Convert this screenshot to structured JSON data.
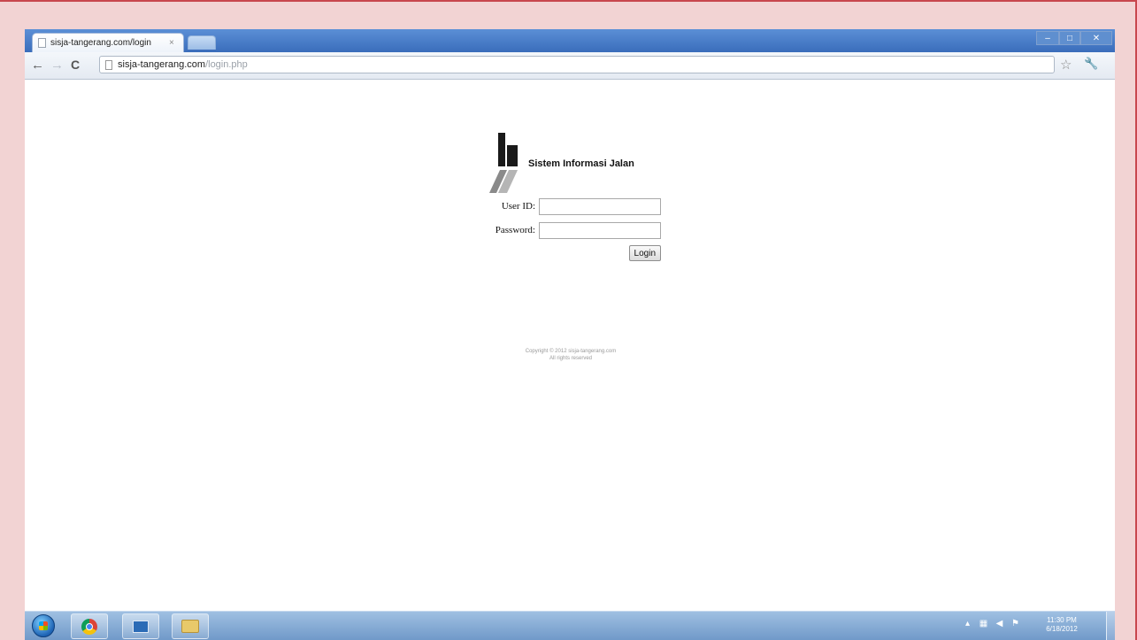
{
  "browser": {
    "tab_title": "sisja-tangerang.com/login",
    "tab_close": "×",
    "url_host": "sisja-tangerang.com",
    "url_path": "/login.php"
  },
  "logo": {
    "title": "Sistem Informasi Jalan"
  },
  "form": {
    "userid_label": "User ID:",
    "userid_value": "",
    "password_label": "Password:",
    "password_value": "",
    "login_label": "Login"
  },
  "footer": {
    "line1": "Copyright © 2012 sisja-tangerang.com",
    "line2": "All rights reserved"
  },
  "taskbar": {
    "clock_time": "11:30 PM",
    "clock_date": "6/18/2012"
  },
  "icons": {
    "back": "back-arrow-icon",
    "forward": "forward-arrow-icon",
    "reload": "reload-icon",
    "star": "star-icon",
    "wrench": "wrench-icon"
  },
  "colors": {
    "frame_background": "#f2d3d3",
    "frame_rule": "#c8474e",
    "tabstrip": "#3a6dbb"
  }
}
